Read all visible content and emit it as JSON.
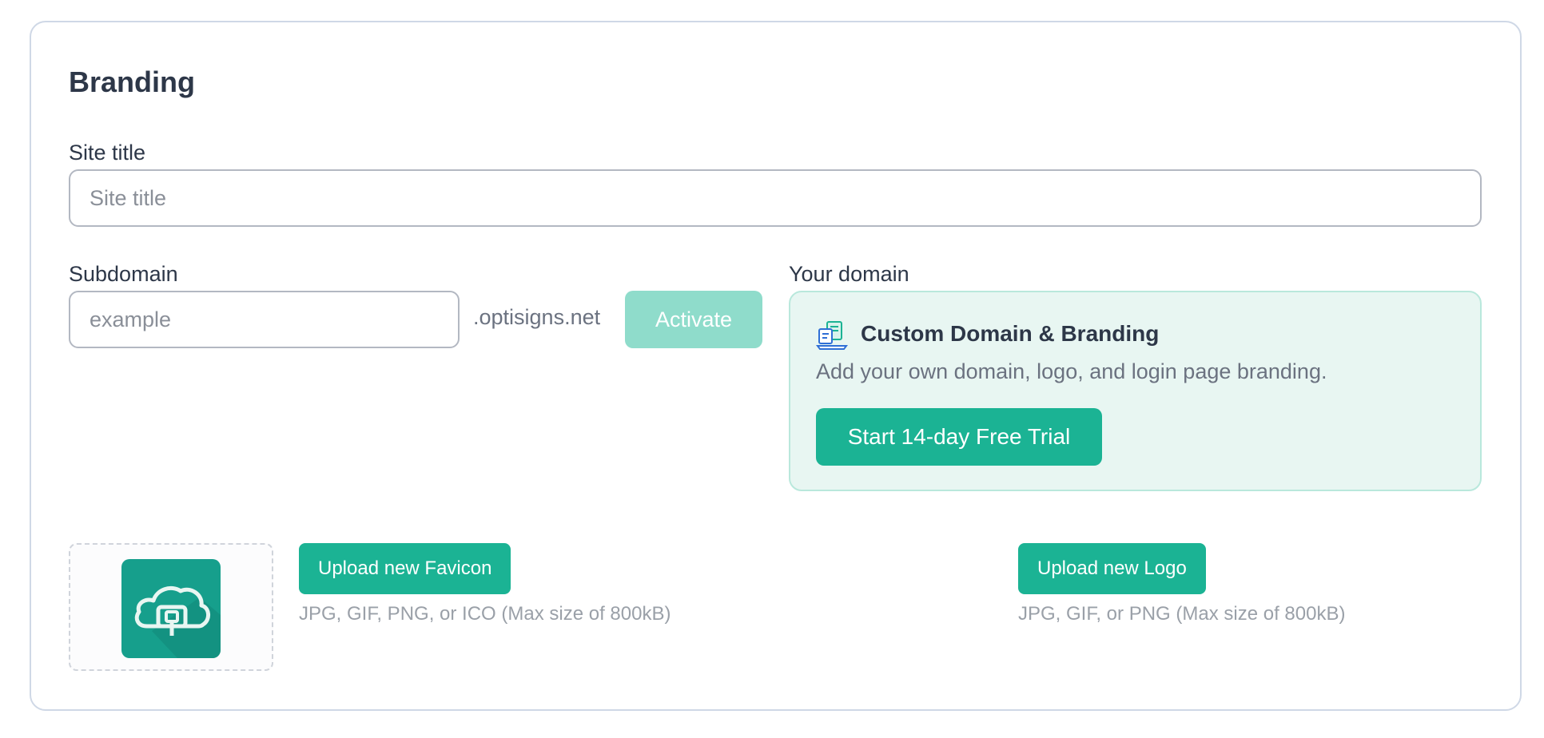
{
  "branding": {
    "title": "Branding",
    "site_title": {
      "label": "Site title",
      "placeholder": "Site title",
      "value": ""
    },
    "subdomain": {
      "label": "Subdomain",
      "placeholder": "example",
      "value": "",
      "suffix": ".optisigns.net",
      "activate_label": "Activate"
    },
    "your_domain": {
      "label": "Your domain",
      "promo": {
        "icon": "branding-screens-icon",
        "title": "Custom Domain & Branding",
        "description": "Add your own domain, logo, and login page branding.",
        "trial_label": "Start 14-day Free Trial"
      }
    },
    "favicon": {
      "image": "cloud-logo-icon",
      "upload_label": "Upload new Favicon",
      "hint": "JPG, GIF, PNG, or ICO (Max size of 800kB)"
    },
    "logo": {
      "upload_label": "Upload new Logo",
      "hint": "JPG, GIF, or PNG (Max size of 800kB)"
    }
  },
  "colors": {
    "accent": "#1bb394",
    "accent_disabled": "#8fdccb",
    "promo_bg": "#e8f6f2",
    "border": "#cfd8e6"
  }
}
